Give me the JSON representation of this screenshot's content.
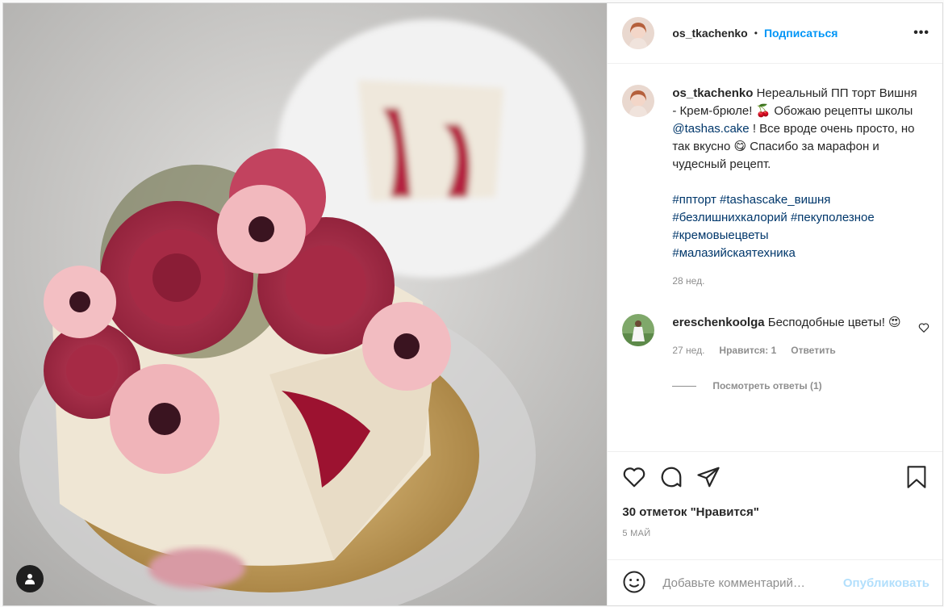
{
  "header": {
    "username": "os_tkachenko",
    "separator": "•",
    "follow_label": "Подписаться",
    "more_label": "•••"
  },
  "caption": {
    "username": "os_tkachenko",
    "text_1": "Нереальный ПП торт Вишня - Крем-брюле! 🍒 Обожаю рецепты школы",
    "mention": "@tashas.cake",
    "text_2": "! Все вроде очень просто, но так вкусно 😋 Спасибо за марафон и чудесный рецепт.",
    "hashtags": [
      "#пп­торт",
      "#tashascake_вишня",
      "#безлишнихкалорий",
      "#пекуполезное",
      "#кремовыецветы",
      "#малазийскаятехника"
    ],
    "time": "28 нед."
  },
  "comment": {
    "username": "ereschenkoolga",
    "text": "Бесподобные цветы! 😍",
    "time": "27 нед.",
    "likes": "Нравится: 1",
    "reply_label": "Ответить",
    "view_replies": "Посмотреть ответы (1)"
  },
  "actions": {
    "likes_text": "30 отметок \"Нравится\"",
    "date": "5 МАЙ"
  },
  "add_comment": {
    "placeholder": "Добавьте комментарий…",
    "publish_label": "Опубликовать"
  },
  "icons": [
    "user-tag-icon",
    "heart-icon",
    "comment-icon",
    "share-icon",
    "bookmark-icon",
    "emoji-icon",
    "small-heart-icon"
  ],
  "colors": {
    "accent": "#0095f6",
    "link": "#00376b",
    "publish_disabled": "#b2dffc",
    "muted": "#8e8e8e"
  }
}
